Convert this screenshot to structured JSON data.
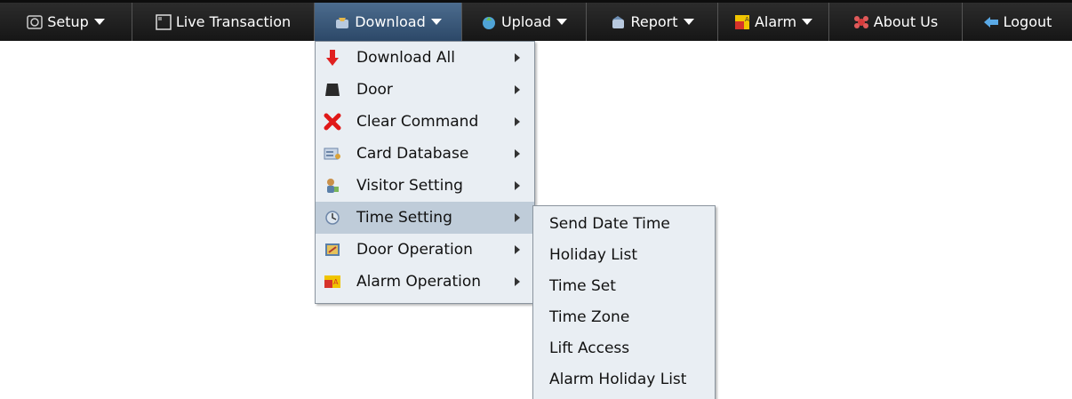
{
  "menubar": {
    "items": [
      {
        "label": "Setup",
        "icon": "setup-icon",
        "has_caret": true
      },
      {
        "label": "Live Transaction",
        "icon": "monitor-icon",
        "has_caret": false
      },
      {
        "label": "Download",
        "icon": "download-icon",
        "has_caret": true,
        "active": true
      },
      {
        "label": "Upload",
        "icon": "upload-icon",
        "has_caret": true
      },
      {
        "label": "Report",
        "icon": "report-icon",
        "has_caret": true
      },
      {
        "label": "Alarm",
        "icon": "alarm-icon",
        "has_caret": true
      },
      {
        "label": "About Us",
        "icon": "about-icon",
        "has_caret": false
      },
      {
        "label": "Logout",
        "icon": "logout-icon",
        "has_caret": false
      }
    ]
  },
  "download_menu": {
    "items": [
      {
        "label": "Download All",
        "icon": "down-arrow-icon"
      },
      {
        "label": "Door",
        "icon": "door-icon"
      },
      {
        "label": "Clear Command",
        "icon": "red-x-icon"
      },
      {
        "label": "Card Database",
        "icon": "card-database-icon"
      },
      {
        "label": "Visitor Setting",
        "icon": "visitor-icon"
      },
      {
        "label": "Time Setting",
        "icon": "clock-icon",
        "highlighted": true
      },
      {
        "label": "Door Operation",
        "icon": "door-operation-icon"
      },
      {
        "label": "Alarm Operation",
        "icon": "alarm-operation-icon"
      }
    ]
  },
  "time_setting_submenu": {
    "items": [
      {
        "label": "Send Date Time"
      },
      {
        "label": "Holiday List"
      },
      {
        "label": "Time Set"
      },
      {
        "label": "Time Zone"
      },
      {
        "label": "Lift Access"
      },
      {
        "label": "Alarm Holiday List"
      }
    ]
  },
  "colors": {
    "menubar_bg": "#1f1f1f",
    "active_tab": "#3d5b7d",
    "menu_bg": "#e9eef3",
    "menu_highlight": "#bfccd9"
  }
}
